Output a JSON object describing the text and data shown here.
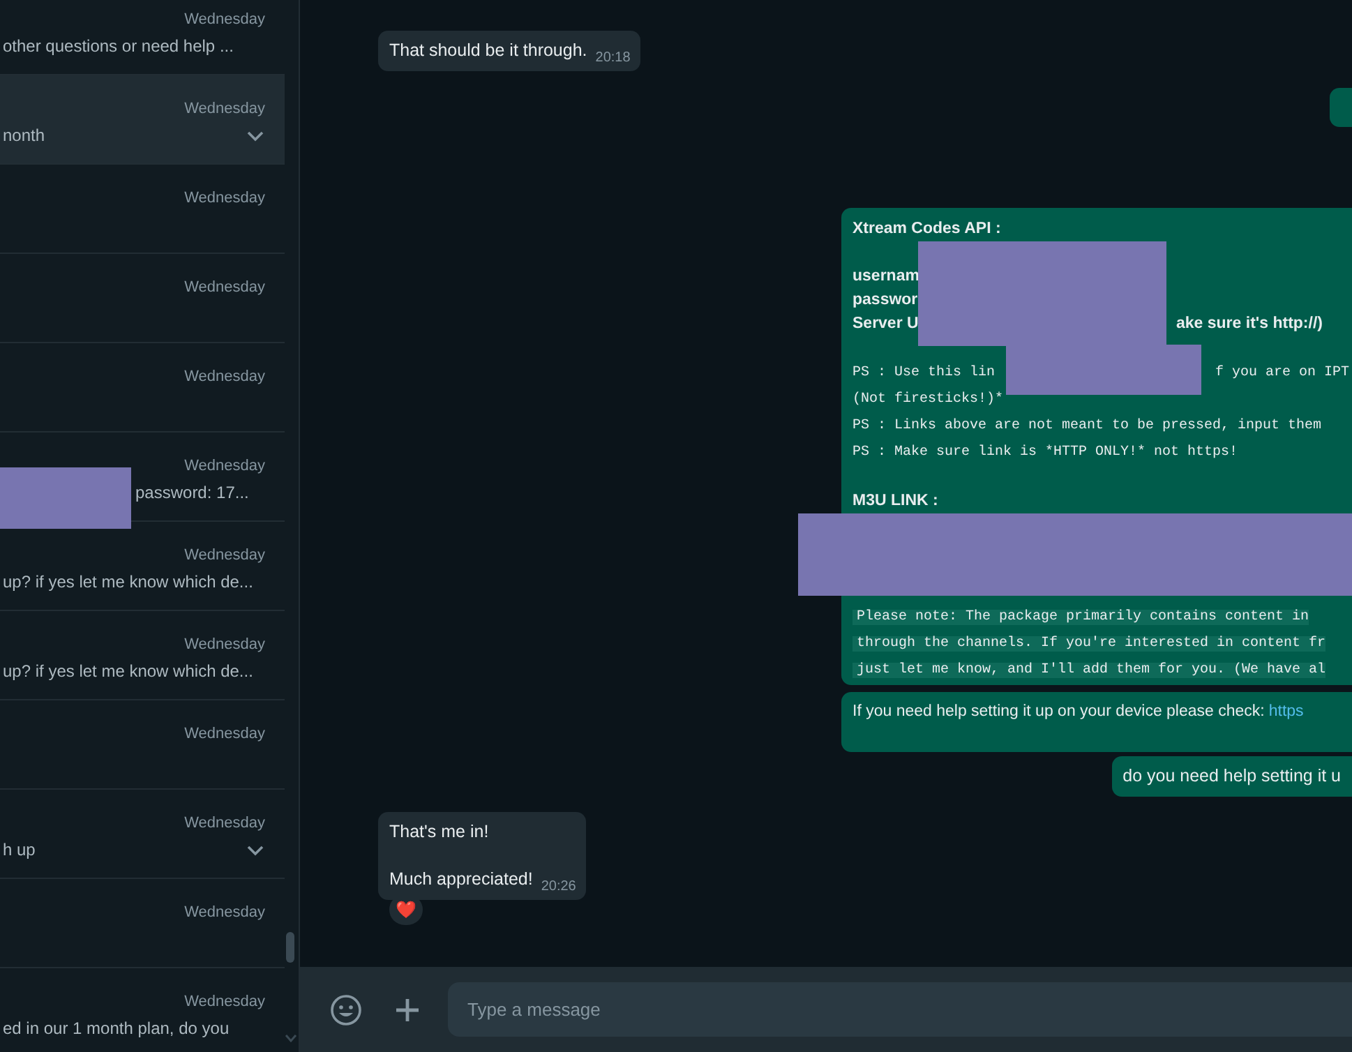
{
  "chat_list": [
    {
      "date": "Wednesday",
      "preview": "other questions or need help ...",
      "selected": false,
      "menu_chevron": false,
      "redacted": false
    },
    {
      "date": "Wednesday",
      "preview": "nonth",
      "selected": true,
      "menu_chevron": true,
      "redacted": false
    },
    {
      "date": "Wednesday",
      "selected": false,
      "menu_chevron": false,
      "redacted": false
    },
    {
      "date": "Wednesday",
      "selected": false,
      "menu_chevron": false,
      "redacted": false
    },
    {
      "date": "Wednesday",
      "selected": false,
      "menu_chevron": false,
      "redacted": false
    },
    {
      "date": "Wednesday",
      "preview": "password: 17...",
      "selected": false,
      "menu_chevron": false,
      "redacted": true
    },
    {
      "date": "Wednesday",
      "preview": "up? if yes let me know which de...",
      "selected": false,
      "menu_chevron": false,
      "redacted": false
    },
    {
      "date": "Wednesday",
      "preview": "up? if yes let me know which de...",
      "selected": false,
      "menu_chevron": false,
      "redacted": false
    },
    {
      "date": "Wednesday",
      "selected": false,
      "menu_chevron": false,
      "redacted": false
    },
    {
      "date": "Wednesday",
      "preview": "h up",
      "selected": false,
      "menu_chevron": true,
      "redacted": false
    },
    {
      "date": "Wednesday",
      "selected": false,
      "menu_chevron": false,
      "redacted": false
    },
    {
      "date": "Wednesday",
      "preview": "ed in our 1 month plan, do you",
      "selected": false,
      "menu_chevron": false,
      "redacted": false
    }
  ],
  "messages": [
    {
      "kind": "incoming",
      "paragraphs": [
        "That should be it through."
      ],
      "time": "20:18"
    },
    {
      "kind": "outgoing_fragment"
    },
    {
      "kind": "outgoing_details",
      "blocks": [
        {
          "kind": "bold",
          "text": "Xtream Codes API :"
        },
        {
          "kind": "gap"
        },
        {
          "kind": "bold",
          "text": "usernam"
        },
        {
          "kind": "bold",
          "text": "passwor"
        },
        {
          "kind": "bold_split",
          "text": "Server U",
          "text_after": "ake sure it's http://)"
        },
        {
          "kind": "gap"
        },
        {
          "kind": "mono_split",
          "text": "PS : Use this lin",
          "text_after": "f you are on IPT"
        },
        {
          "kind": "mono",
          "text": "(Not firesticks!)*"
        },
        {
          "kind": "mono",
          "text": "PS : Links above are not meant to be pressed, input them"
        },
        {
          "kind": "mono",
          "text": "PS : Make sure link is *HTTP ONLY!* not https!"
        },
        {
          "kind": "gap"
        },
        {
          "kind": "bold",
          "text": "M3U LINK :"
        },
        {
          "kind": "redacted"
        },
        {
          "kind": "code",
          "text": "Please note: The package primarily contains content in"
        },
        {
          "kind": "code",
          "text": "through the channels. If you're interested in content fr"
        },
        {
          "kind": "code",
          "text": "just let me know, and I'll add them for you. (We have al"
        }
      ]
    },
    {
      "kind": "outgoing",
      "paragraphs": [
        "If you need help setting it up on your device please check:"
      ],
      "link": "https"
    },
    {
      "kind": "outgoing",
      "paragraphs": [
        "do you need help setting it u"
      ]
    },
    {
      "kind": "incoming",
      "paragraphs": [
        "That's me in!",
        "Much appreciated!"
      ],
      "time": "20:26",
      "reaction": "❤️"
    }
  ],
  "composer": {
    "placeholder": "Type a message"
  }
}
